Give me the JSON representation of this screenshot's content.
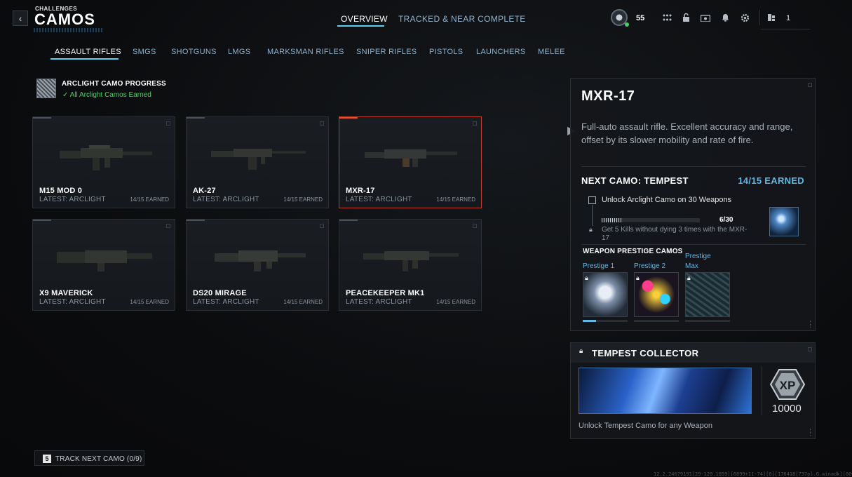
{
  "header": {
    "section": "CHALLENGES",
    "title": "CAMOS",
    "tabs": [
      {
        "label": "OVERVIEW",
        "active": true
      },
      {
        "label": "TRACKED & NEAR COMPLETE",
        "active": false
      }
    ],
    "player_level": "55",
    "party_count": "1",
    "icons": [
      "player-emblem-icon",
      "grid-icon",
      "lock-icon",
      "camera-icon",
      "bell-icon",
      "gear-icon",
      "party-icon"
    ]
  },
  "categories": [
    {
      "label": "ASSAULT RIFLES",
      "active": true
    },
    {
      "label": "SMGS"
    },
    {
      "label": "SHOTGUNS"
    },
    {
      "label": "LMGS"
    },
    {
      "label": "MARKSMAN RIFLES"
    },
    {
      "label": "SNIPER RIFLES"
    },
    {
      "label": "PISTOLS"
    },
    {
      "label": "LAUNCHERS"
    },
    {
      "label": "MELEE"
    }
  ],
  "progress": {
    "title": "ARCLIGHT CAMO PROGRESS",
    "status": "All Arclight Camos Earned"
  },
  "weapons": [
    {
      "name": "M15 MOD 0",
      "latest": "LATEST: ARCLIGHT",
      "earned": "14/15 EARNED",
      "selected": false
    },
    {
      "name": "AK-27",
      "latest": "LATEST: ARCLIGHT",
      "earned": "14/15 EARNED",
      "selected": false
    },
    {
      "name": "MXR-17",
      "latest": "LATEST: ARCLIGHT",
      "earned": "14/15 EARNED",
      "selected": true
    },
    {
      "name": "X9 MAVERICK",
      "latest": "LATEST: ARCLIGHT",
      "earned": "14/15 EARNED",
      "selected": false
    },
    {
      "name": "DS20 MIRAGE",
      "latest": "LATEST: ARCLIGHT",
      "earned": "14/15 EARNED",
      "selected": false
    },
    {
      "name": "PEACEKEEPER MK1",
      "latest": "LATEST: ARCLIGHT",
      "earned": "14/15 EARNED",
      "selected": false
    }
  ],
  "detail": {
    "title": "MXR-17",
    "description": "Full-auto assault rifle. Excellent accuracy and range, offset by its slower mobility and rate of fire.",
    "next_camo": "NEXT CAMO: TEMPEST",
    "next_earned": "14/15 EARNED",
    "challenge": {
      "title": "Unlock Arclight Camo on 30 Weapons",
      "progress_text": "6/30",
      "progress_fraction": 0.2,
      "description": "Get 5 Kills without dying 3 times with the MXR-17"
    },
    "prestige_title": "WEAPON PRESTIGE CAMOS",
    "prestige": [
      {
        "label": "Prestige 1",
        "progress": 0.3
      },
      {
        "label": "Prestige 2",
        "progress": 0
      },
      {
        "label": "Prestige Max",
        "progress": 0
      }
    ]
  },
  "collector": {
    "title": "TEMPEST COLLECTOR",
    "xp_label": "XP",
    "xp_amount": "10000",
    "description": "Unlock Tempest Camo for any Weapon"
  },
  "footer": {
    "track_key": "5",
    "track_label": "TRACK NEXT CAMO (0/9)",
    "build": "12.2.24679191[29-120.1059][6899+11-74][0][176418[737pl.G.winadk][0001228680]"
  },
  "colors": {
    "accent": "#5fd0f0",
    "earned_green": "#3fd45e",
    "selected_border": "#c0412a",
    "earned_blue": "#5fb8e6"
  }
}
